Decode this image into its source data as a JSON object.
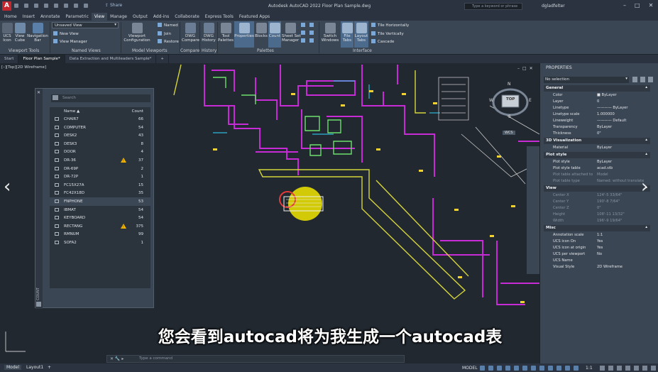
{
  "title_bar": {
    "title": "Autodesk AutoCAD 2022   Floor Plan Sample.dwg",
    "share_label": "Share",
    "search_placeholder": "Type a keyword or phrase",
    "user_name": "dgladfelter",
    "logo_text": "A"
  },
  "ribbon_tabs": [
    {
      "label": "Home"
    },
    {
      "label": "Insert"
    },
    {
      "label": "Annotate"
    },
    {
      "label": "Parametric"
    },
    {
      "label": "View",
      "active": true
    },
    {
      "label": "Manage"
    },
    {
      "label": "Output"
    },
    {
      "label": "Add-ins"
    },
    {
      "label": "Collaborate"
    },
    {
      "label": "Express Tools"
    },
    {
      "label": "Featured Apps"
    }
  ],
  "ribbon": {
    "ucs_icon": "UCS\nIcon",
    "view_cube": "View\nCube",
    "navigation_bar": "Navigation\nBar",
    "viewport_tools": "Viewport Tools",
    "named_view_select": "Unsaved View",
    "new_view": "New View",
    "view_manager": "View Manager",
    "named_views": "Named Views",
    "viewport_configuration": "Viewport\nConfiguration",
    "named": "Named",
    "join": "Join",
    "restore": "Restore",
    "model_viewports": "Model Viewports",
    "dwg_compare": "DWG\nCompare",
    "compare": "Compare",
    "dwg_history": "DWG\nHistory",
    "history": "History",
    "tool_palettes": "Tool\nPalettes",
    "properties": "Properties",
    "blocks": "Blocks",
    "count": "Count",
    "sheet_set_manager": "Sheet Set\nManager",
    "palettes": "Palettes",
    "switch_windows": "Switch\nWindows",
    "file_tabs": "File\nTabs",
    "layout_tabs": "Layout\nTabs",
    "tile_horizontally": "Tile Horizontally",
    "tile_vertically": "Tile Vertically",
    "cascade": "Cascade",
    "interface": "Interface"
  },
  "file_tabs": [
    {
      "label": "Start"
    },
    {
      "label": "Floor Plan Sample*",
      "active": true
    },
    {
      "label": "Data Extraction and Multileaders Sample*"
    },
    {
      "label": "+"
    }
  ],
  "view_label": "[–][Top][2D Wireframe]",
  "viewcube": {
    "top": "TOP",
    "n": "N",
    "w": "W",
    "e": "E",
    "s": "S",
    "wcs": "WCS"
  },
  "count_palette": {
    "search_placeholder": "Search",
    "col_name": "Name ▲",
    "col_count": "Count",
    "vertical_title": "COUNT",
    "rows": [
      {
        "name": "CHAIR7",
        "count": "66"
      },
      {
        "name": "COMPUTER",
        "count": "54"
      },
      {
        "name": "DESK2",
        "count": "43"
      },
      {
        "name": "DESK3",
        "count": "8"
      },
      {
        "name": "DOOR",
        "count": "4"
      },
      {
        "name": "DR-36",
        "count": "37",
        "warning": true
      },
      {
        "name": "DR-69P",
        "count": "2"
      },
      {
        "name": "DR-72P",
        "count": "1"
      },
      {
        "name": "FC15X27A",
        "count": "15"
      },
      {
        "name": "FC42X18D",
        "count": "35"
      },
      {
        "name": "FNPHONE",
        "count": "53",
        "selected": true
      },
      {
        "name": "IBMAT",
        "count": "54"
      },
      {
        "name": "KEYBOARD",
        "count": "54"
      },
      {
        "name": "RECTANG",
        "count": "375",
        "warning": true
      },
      {
        "name": "RMNUM",
        "count": "99"
      },
      {
        "name": "SOFA2",
        "count": "1"
      }
    ]
  },
  "properties_palette": {
    "header": "PROPERTIES",
    "selection": "No selection",
    "sections": [
      {
        "title": "General",
        "rows": [
          [
            "Color",
            "■ ByLayer"
          ],
          [
            "Layer",
            "0"
          ],
          [
            "Linetype",
            "———— ByLayer"
          ],
          [
            "Linetype scale",
            "1.000000"
          ],
          [
            "Lineweight",
            "———— Default"
          ],
          [
            "Transparency",
            "ByLayer"
          ],
          [
            "Thickness",
            "0\""
          ]
        ]
      },
      {
        "title": "3D Visualization",
        "rows": [
          [
            "Material",
            "ByLayer"
          ]
        ]
      },
      {
        "title": "Plot style",
        "rows": [
          [
            "Plot style",
            "ByLayer"
          ],
          [
            "Plot style table",
            "acad.stb"
          ],
          [
            "Plot table attached to",
            "Model",
            "dim"
          ],
          [
            "Plot table type",
            "Named: without  translate",
            "dim"
          ]
        ]
      },
      {
        "title": "View",
        "rows": [
          [
            "Center X",
            "124'-5 33/64\"",
            "dim"
          ],
          [
            "Center Y",
            "190'-8 7/64\"",
            "dim"
          ],
          [
            "Center Z",
            "0\"",
            "dim"
          ],
          [
            "Height",
            "108'-11 13/32\"",
            "dim"
          ],
          [
            "Width",
            "196'-9 19/64\"",
            "dim"
          ]
        ]
      },
      {
        "title": "Misc",
        "rows": [
          [
            "Annotation scale",
            "1:1"
          ],
          [
            "UCS icon On",
            "Yes"
          ],
          [
            "UCS icon at origin",
            "Yes"
          ],
          [
            "UCS per viewport",
            "No"
          ],
          [
            "UCS Name",
            ""
          ],
          [
            "Visual Style",
            "2D Wireframe"
          ]
        ]
      }
    ]
  },
  "command_line": {
    "placeholder": "Type a command"
  },
  "status_bar": {
    "model_tab": "Model",
    "layout_tab": "Layout1",
    "model_label": "MODEL",
    "scale": "1:1"
  },
  "subtitle": "您会看到autocad将为我生成一个autocad表",
  "colors": {
    "accent": "#3b4654",
    "drawing_bg": "#212830",
    "magenta_walls": "#c72bd6",
    "highlight": "#f2e600"
  }
}
